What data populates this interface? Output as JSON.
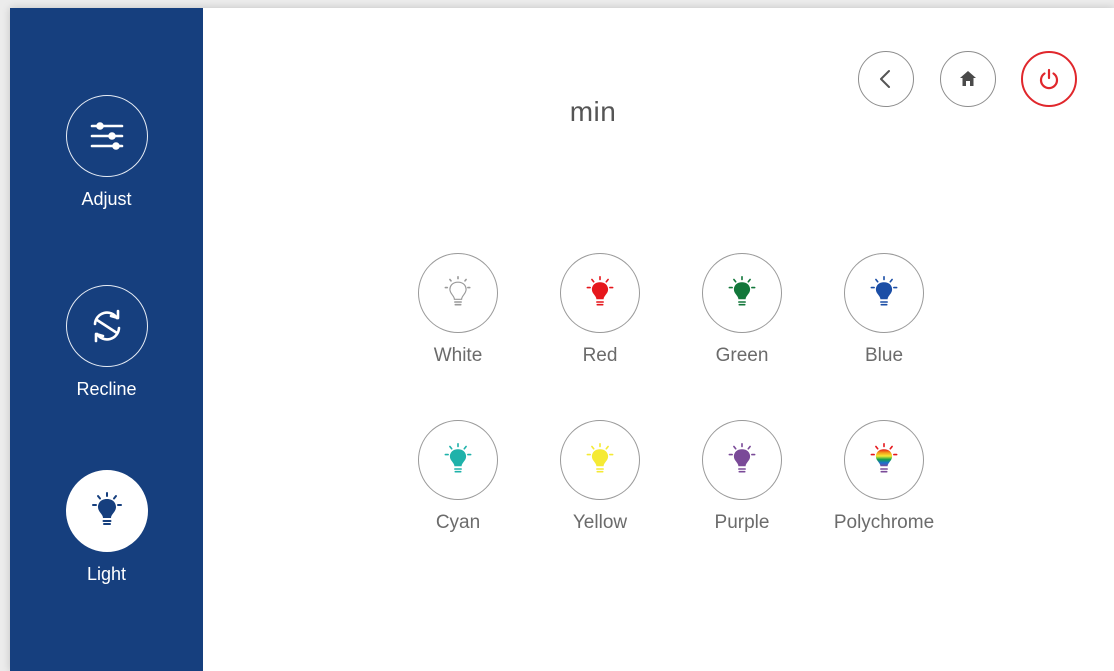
{
  "sidebar": {
    "items": [
      {
        "label": "Adjust",
        "icon": "sliders-icon",
        "active": false
      },
      {
        "label": "Recline",
        "icon": "recline-arrows-icon",
        "active": false
      },
      {
        "label": "Light",
        "icon": "lightbulb-icon",
        "active": true
      }
    ]
  },
  "header": {
    "title": "min",
    "buttons": [
      {
        "name": "back-button",
        "icon": "chevron-left-icon"
      },
      {
        "name": "home-button",
        "icon": "home-icon"
      },
      {
        "name": "power-button",
        "icon": "power-icon",
        "color": "#e0272c"
      }
    ]
  },
  "colors": {
    "items": [
      {
        "label": "White",
        "color": "#ffffff"
      },
      {
        "label": "Red",
        "color": "#e6171c"
      },
      {
        "label": "Green",
        "color": "#12773a"
      },
      {
        "label": "Blue",
        "color": "#1b4ea6"
      },
      {
        "label": "Cyan",
        "color": "#1fb2aa"
      },
      {
        "label": "Yellow",
        "color": "#f5ea34"
      },
      {
        "label": "Purple",
        "color": "#7a4a98"
      },
      {
        "label": "Polychrome",
        "color": "rainbow"
      }
    ]
  },
  "theme": {
    "sidebar_bg": "#163f7e",
    "accent_red": "#e0272c"
  }
}
